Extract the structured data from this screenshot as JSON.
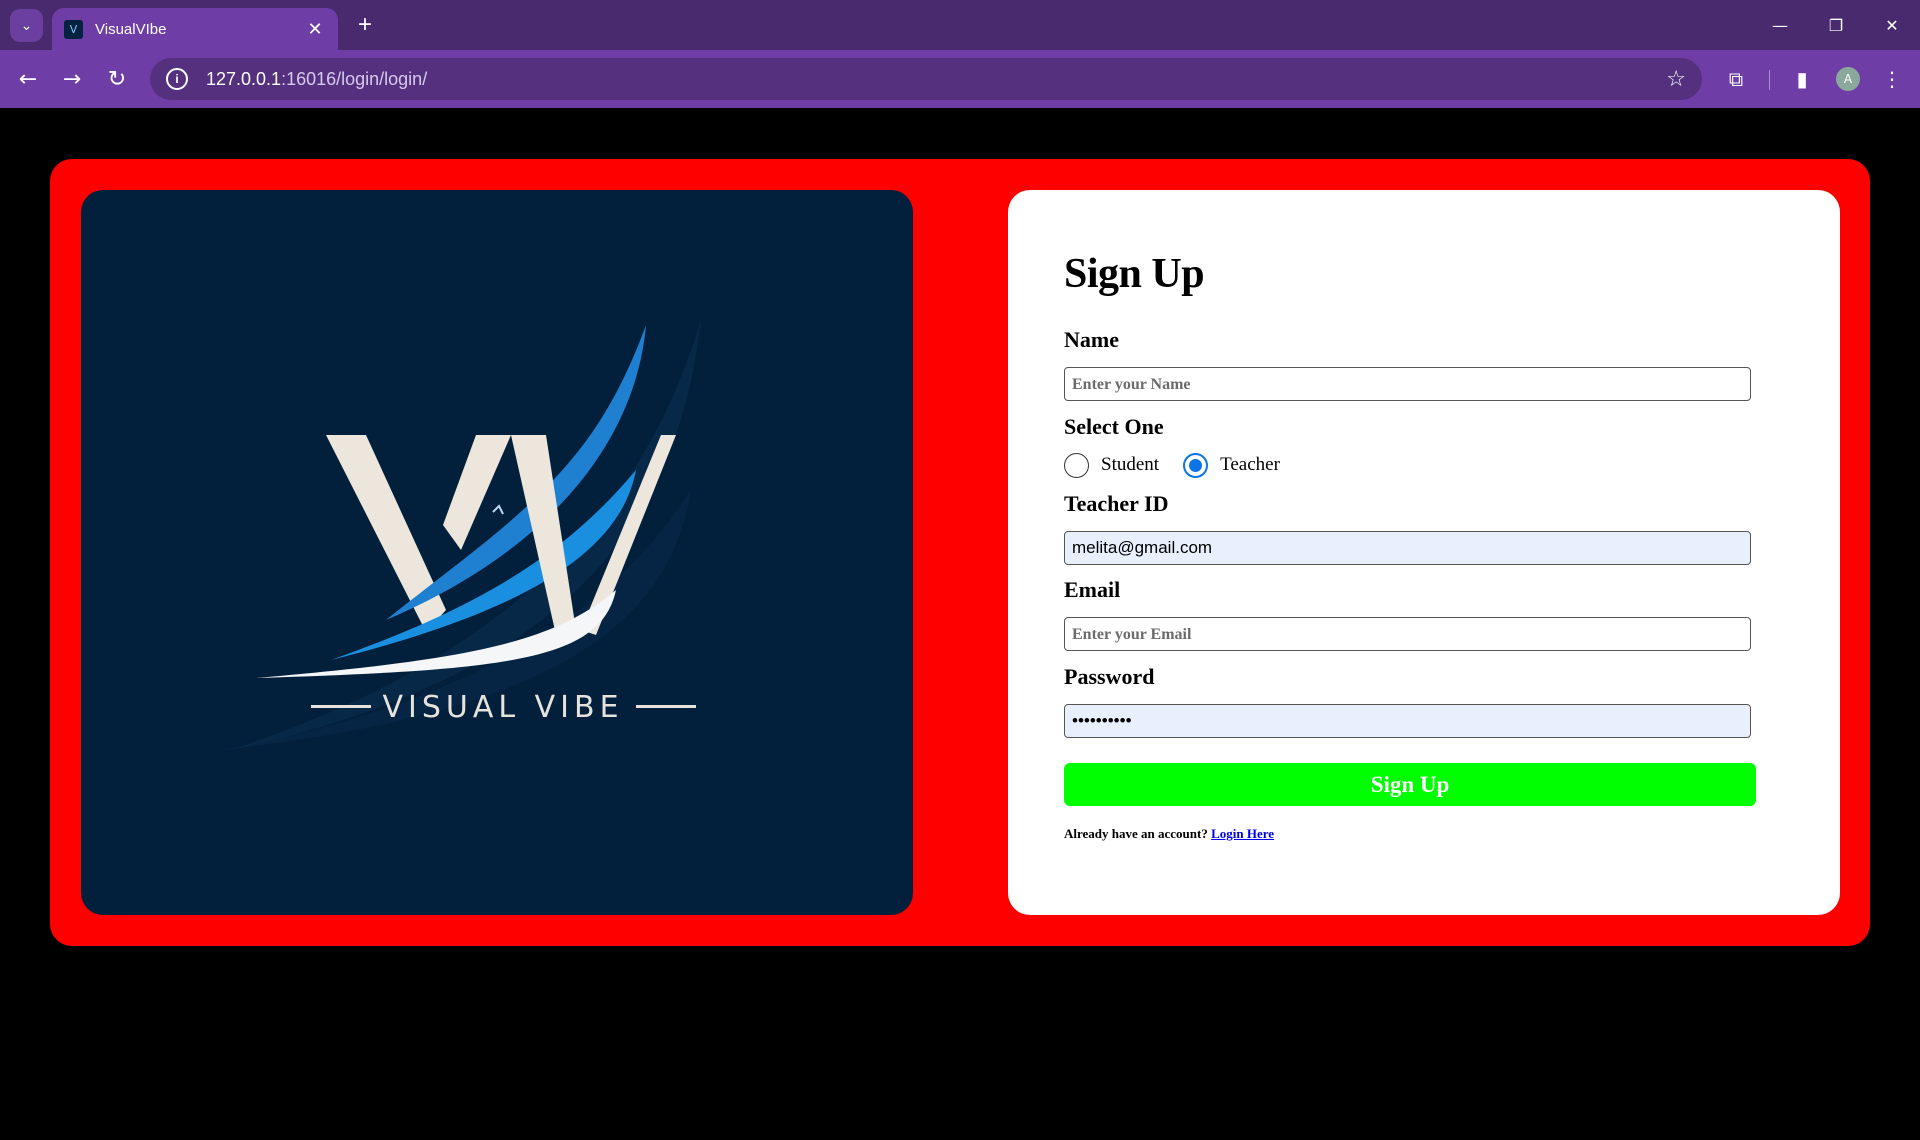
{
  "browser": {
    "tab_title": "VisualVIbe",
    "tab_close": "✕",
    "new_tab": "+",
    "url_host": "127.0.0.1",
    "url_path": ":16016/login/login/",
    "avatar_letter": "A",
    "icons": [
      "chevron-down-icon",
      "site-favicon",
      "close-icon",
      "plus-icon",
      "minimize-icon",
      "restore-icon",
      "close-window-icon",
      "back-icon",
      "forward-icon",
      "reload-icon",
      "site-info-icon",
      "star-icon",
      "extensions-icon",
      "side-panel-icon",
      "avatar",
      "menu-icon"
    ]
  },
  "logo": {
    "brand_text": "VISUAL VIBE",
    "colors": {
      "panel": "#02203c",
      "letter": "#ece6dc",
      "sail_light": "#2a86d6",
      "sail_dark": "#1268c2",
      "hull": "#f4f6f8"
    }
  },
  "form": {
    "title": "Sign Up",
    "name_label": "Name",
    "name_placeholder": "Enter your Name",
    "select_label": "Select One",
    "role_options": [
      {
        "label": "Student",
        "checked": false
      },
      {
        "label": "Teacher",
        "checked": true
      }
    ],
    "teacher_id_label": "Teacher ID",
    "teacher_id_value": "melita@gmail.com",
    "email_label": "Email",
    "email_placeholder": "Enter your Email",
    "password_label": "Password",
    "password_value": "••••••••••",
    "submit_label": "Sign Up",
    "login_prompt": "Already have an account?",
    "login_link": "Login Here"
  },
  "colors": {
    "page_bg": "#000000",
    "frame": "#ff0000",
    "form_panel": "#ffffff",
    "submit_bg": "#00ff00",
    "chrome": "#6f3da6",
    "radio_accent": "#0b74e6"
  }
}
